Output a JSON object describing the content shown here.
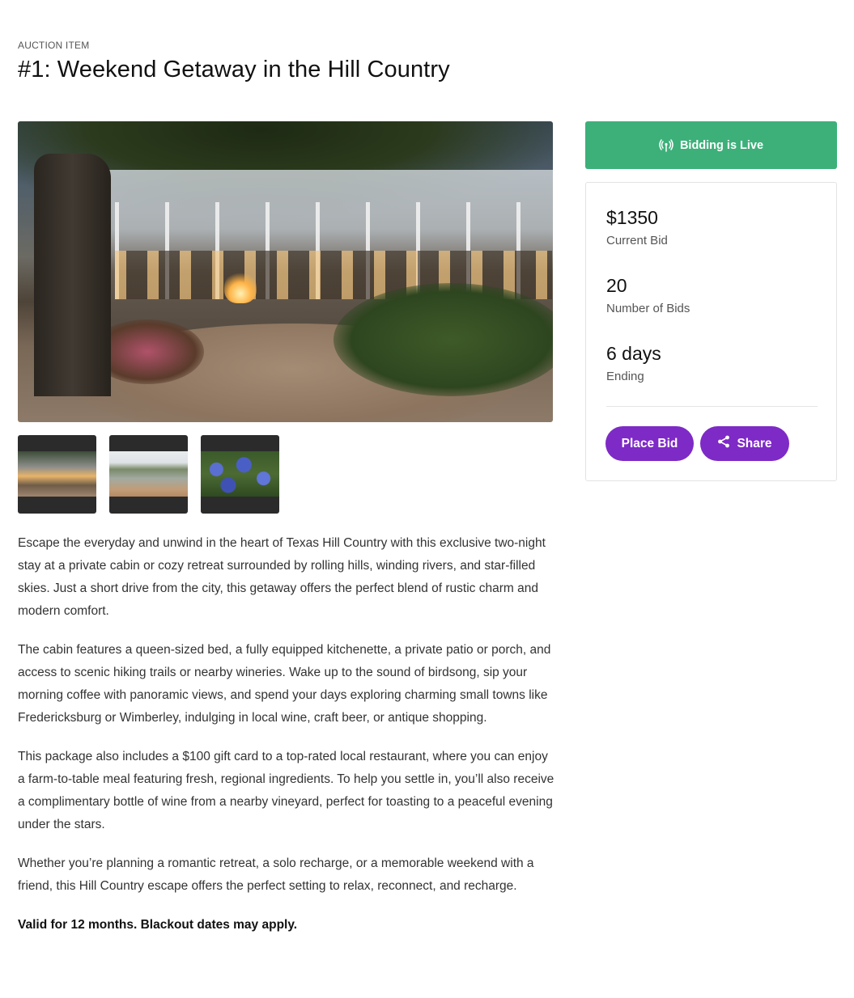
{
  "header": {
    "eyebrow": "AUCTION ITEM",
    "title": "#1: Weekend Getaway in the Hill Country"
  },
  "gallery": {
    "thumbnails": [
      "thumbnail-1",
      "thumbnail-2",
      "thumbnail-3"
    ]
  },
  "description": {
    "paragraphs": [
      "Escape the everyday and unwind in the heart of Texas Hill Country with this exclusive two-night stay at a private cabin or cozy retreat surrounded by rolling hills, winding rivers, and star-filled skies. Just a short drive from the city, this getaway offers the perfect blend of rustic charm and modern comfort.",
      "The cabin features a queen-sized bed, a fully equipped kitchenette, a private patio or porch, and access to scenic hiking trails or nearby wineries. Wake up to the sound of birdsong, sip your morning coffee with panoramic views, and spend your days exploring charming small towns like Fredericksburg or Wimberley, indulging in local wine, craft beer, or antique shopping.",
      "This package also includes a $100 gift card to a top-rated local restaurant, where you can enjoy a farm-to-table meal featuring fresh, regional ingredients. To help you settle in, you’ll also receive a complimentary bottle of wine from a nearby vineyard, perfect for toasting to a peaceful evening under the stars.",
      "Whether you’re planning a romantic retreat, a solo recharge, or a memorable weekend with a friend, this Hill Country escape offers the perfect setting to relax, reconnect, and recharge."
    ],
    "note": "Valid for 12 months. Blackout dates may apply."
  },
  "status": {
    "label": "Bidding is Live",
    "icon": "broadcast-icon",
    "color": "#3db07a"
  },
  "stats": {
    "current_bid": {
      "value": "$1350",
      "label": "Current Bid"
    },
    "num_bids": {
      "value": "20",
      "label": "Number of Bids"
    },
    "ending": {
      "value": "6 days",
      "label": "Ending"
    }
  },
  "actions": {
    "place_bid": "Place Bid",
    "share": "Share",
    "accent": "#7e2ac6"
  }
}
